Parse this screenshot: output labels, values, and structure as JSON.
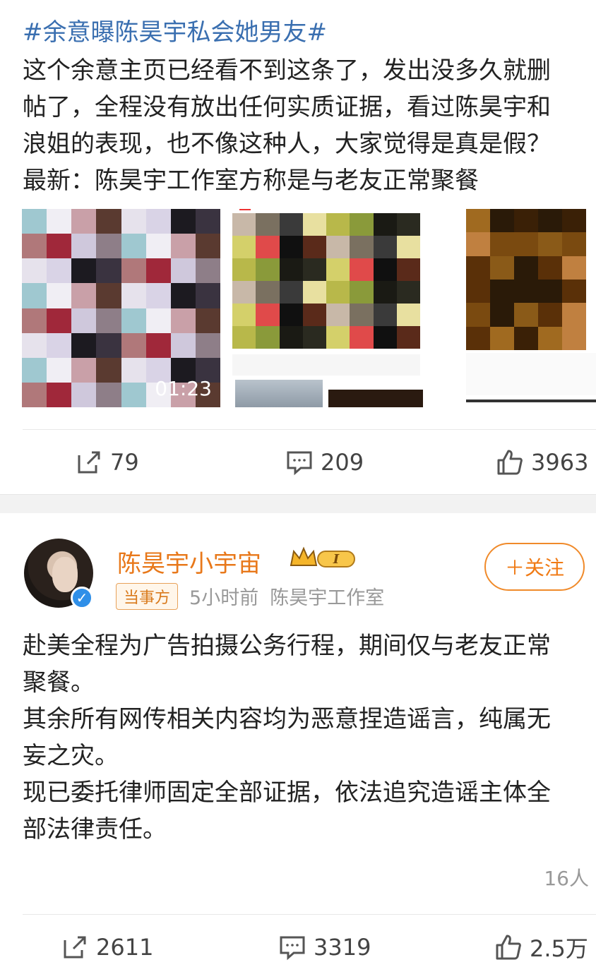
{
  "post1": {
    "hashtag": "#余意曝陈昊宇私会她男友#",
    "lines": [
      "这个余意主页已经看不到这条了，发出没多久就删",
      "帖了，全程没有放出任何实质证据，看过陈昊宇和",
      "浪姐的表现，也不像这种人，大家觉得是真是假？",
      "最新：陈昊宇工作室方称是与老友正常聚餐"
    ],
    "video_duration": "01:23",
    "actions": {
      "repost": "79",
      "comment": "209",
      "like": "3963"
    }
  },
  "post2": {
    "username": "陈昊宇小宇宙",
    "level_badge": "I",
    "tag": "当事方",
    "time": "5小时前",
    "source": "陈昊宇工作室",
    "follow_label": "＋关注",
    "lines": [
      "赴美全程为广告拍摄公务行程，期间仅与老友正常",
      "聚餐。",
      "其余所有网传相关内容均为恶意捏造谣言，纯属无",
      "妄之灾。",
      "现已委托律师固定全部证据，依法追究造谣主体全",
      "部法律责任。"
    ],
    "people": "16人",
    "actions": {
      "repost": "2611",
      "comment": "3319",
      "like": "2.5万"
    }
  },
  "colors": {
    "link": "#3a6fb0",
    "username": "#e8781a",
    "follow": "#f07a14",
    "verified": "#2f8fe8"
  }
}
